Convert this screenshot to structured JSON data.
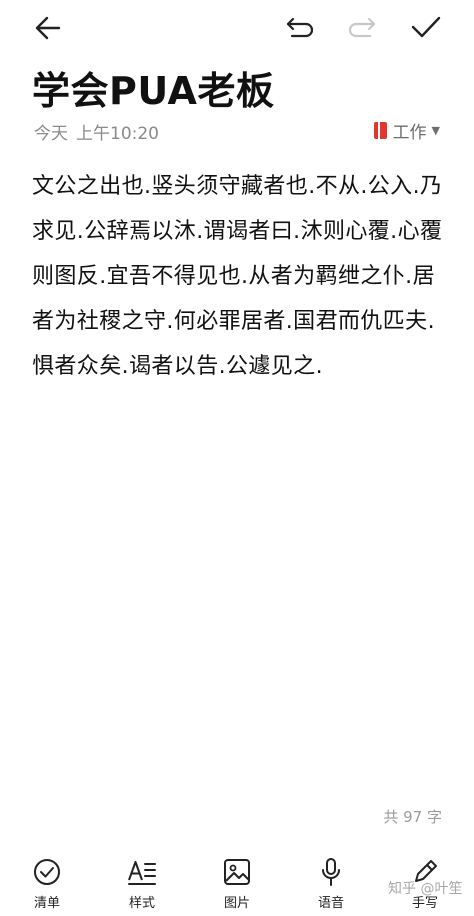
{
  "note": {
    "title": "学会PUA老板",
    "date": "今天",
    "time": "上午10:20",
    "category": "工作",
    "body": "文公之出也.竖头须守藏者也.不从.公入.乃求见.公辞焉以沐.谓谒者曰.沐则心覆.心覆则图反.宜吾不得见也.从者为羁绁之仆.居者为社稷之守.何必罪居者.国君而仇匹夫.惧者众矣.谒者以告.公遽见之.",
    "word_count": "共 97 字"
  },
  "toolbar": {
    "back_icon": "arrow-left-icon",
    "undo_icon": "undo-icon",
    "redo_icon": "redo-icon",
    "done_icon": "checkmark-icon",
    "redo_enabled": false
  },
  "bottom_bar": {
    "checklist_label": "清单",
    "style_label": "样式",
    "image_label": "图片",
    "voice_label": "语音",
    "handwrite_label": "手写"
  },
  "watermark": "知乎 @叶笙",
  "colors": {
    "category_accent": "#e2352d",
    "meta_gray": "#8a8a8a"
  }
}
